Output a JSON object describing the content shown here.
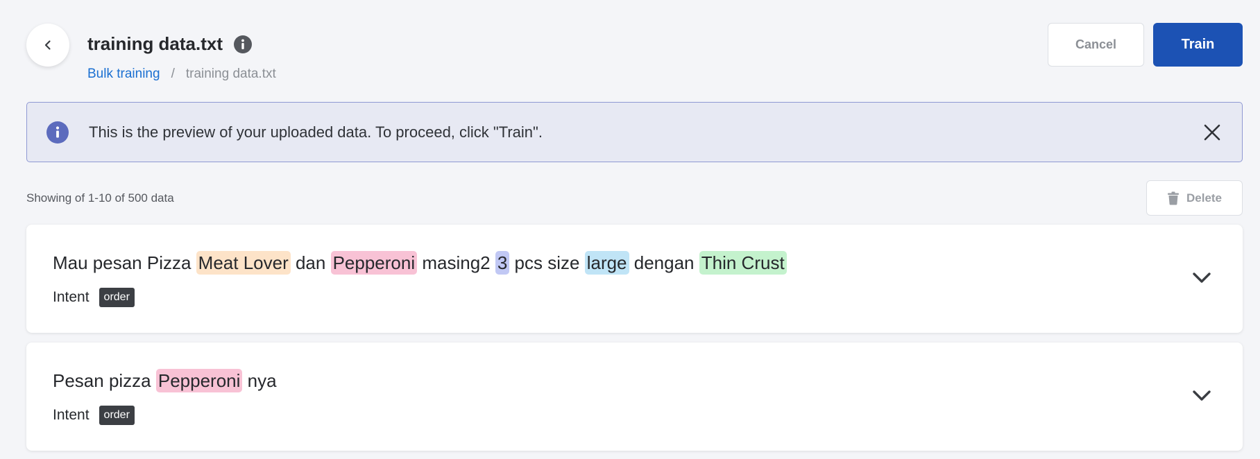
{
  "header": {
    "title": "training data.txt",
    "breadcrumb": [
      {
        "label": "Bulk training"
      },
      {
        "separator": "/"
      },
      {
        "label": "training data.txt"
      }
    ],
    "cancel_label": "Cancel",
    "train_label": "Train"
  },
  "banner": {
    "text": "This is the preview of your uploaded data. To proceed, click \"Train\"."
  },
  "toolbar": {
    "showing_text": "Showing of 1-10 of 500 data",
    "delete_label": "Delete"
  },
  "items": [
    {
      "segments": [
        {
          "text": "Mau pesan Pizza "
        },
        {
          "text": "Meat Lover",
          "color": "#fde3c8"
        },
        {
          "text": " dan "
        },
        {
          "text": "Pepperoni",
          "color": "#f8c2d5"
        },
        {
          "text": " masing2 "
        },
        {
          "text": "3",
          "color": "#c1c8f4"
        },
        {
          "text": " pcs size "
        },
        {
          "text": "large",
          "color": "#c0e4f6"
        },
        {
          "text": " dengan "
        },
        {
          "text": "Thin Crust",
          "color": "#c4f2cd"
        }
      ],
      "intent_label": "Intent",
      "intent_value": "order"
    },
    {
      "segments": [
        {
          "text": "Pesan pizza "
        },
        {
          "text": "Pepperoni",
          "color": "#f8c2d5"
        },
        {
          "text": " nya"
        }
      ],
      "intent_label": "Intent",
      "intent_value": "order"
    }
  ],
  "icons": {
    "back": "chevron-left-icon",
    "title_info": "info-icon",
    "banner_info": "info-icon",
    "banner_close": "close-icon",
    "delete": "trash-icon",
    "expand": "chevron-down-icon"
  },
  "colors": {
    "primary": "#1c52b4",
    "link": "#1a6fd1",
    "banner_bg": "#e7e9f3",
    "banner_border": "#8e98d3",
    "badge_bg": "#3c3f44"
  }
}
